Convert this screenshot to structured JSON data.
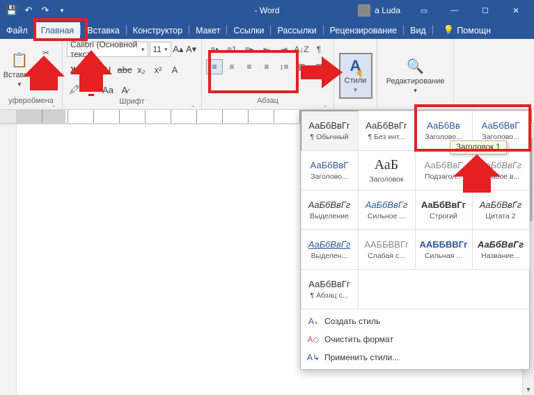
{
  "titlebar": {
    "title": "- Word",
    "user": "a Luda"
  },
  "tabs": {
    "file": "Файл",
    "home": "Главная",
    "insert": "Вставка",
    "design": "Конструктор",
    "layout": "Макет",
    "references": "Ссылки",
    "mailings": "Рассылки",
    "review": "Рецензирование",
    "view": "Вид",
    "help": "Помощн"
  },
  "ribbon": {
    "clipboard": {
      "paste": "Вставить",
      "label": "уферобмена"
    },
    "font": {
      "name": "Calibri (Основной текст",
      "size": "11",
      "label": "Шрифт"
    },
    "paragraph": {
      "label": "Абзац"
    },
    "styles": {
      "button": "Стили"
    },
    "editing": {
      "button": "Редактирование"
    }
  },
  "gallery": {
    "preview_sample": "АаБбВвГг",
    "big_sample": "АаБ",
    "items": [
      [
        {
          "prev": "АаБбВвГг",
          "name": "¶ Обычный",
          "cls": ""
        },
        {
          "prev": "АаБбВвГг",
          "name": "¶ Без инт...",
          "cls": ""
        },
        {
          "prev": "АаБбВв",
          "name": "Заголово...",
          "cls": "blue"
        },
        {
          "prev": "АаБбВвГ",
          "name": "Заголово...",
          "cls": "blue"
        }
      ],
      [
        {
          "prev": "АаБбВвГ",
          "name": "Заголово...",
          "cls": "blue"
        },
        {
          "prev": "АаБ",
          "name": "Заголовок",
          "cls": "big"
        },
        {
          "prev": "АаБбВвГ",
          "name": "Подзагол...",
          "cls": "gray"
        },
        {
          "prev": "АаБбВвГг",
          "name": "Слабое в...",
          "cls": "it gray"
        }
      ],
      [
        {
          "prev": "АаБбВвГг",
          "name": "Выделение",
          "cls": "it"
        },
        {
          "prev": "АаБбВвГг",
          "name": "Сильное ...",
          "cls": "it blue"
        },
        {
          "prev": "АаБбВвГг",
          "name": "Строгий",
          "cls": "b"
        },
        {
          "prev": "АаБбВвГг",
          "name": "Цитата 2",
          "cls": "it"
        }
      ],
      [
        {
          "prev": "АаБбВвГг",
          "name": "Выделен...",
          "cls": "it blue ul"
        },
        {
          "prev": "ААББВВГг",
          "name": "Слабая с...",
          "cls": "gray"
        },
        {
          "prev": "ААББВВГг",
          "name": "Сильная ...",
          "cls": "b blue"
        },
        {
          "prev": "АаБбВвГг",
          "name": "Название...",
          "cls": "b it"
        }
      ],
      [
        {
          "prev": "АаБбВвГг",
          "name": "¶ Абзац с...",
          "cls": ""
        }
      ]
    ],
    "menu": {
      "create": "Создать стиль",
      "clear": "Очистить формат",
      "apply": "Применить стили..."
    }
  },
  "tooltip": "Заголовок 1"
}
